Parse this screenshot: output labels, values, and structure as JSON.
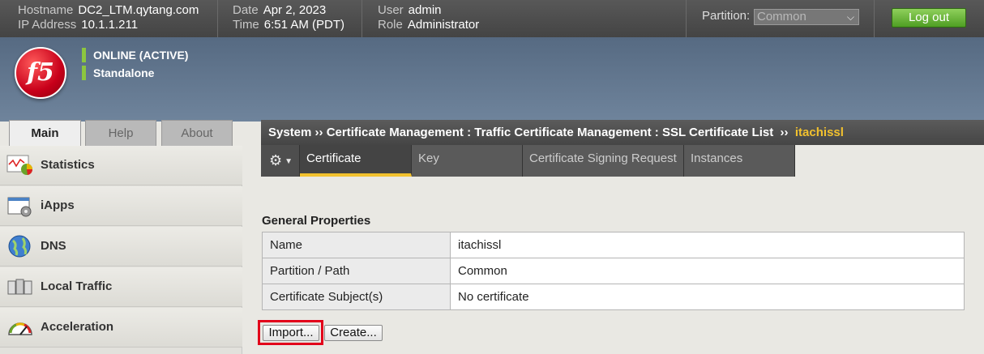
{
  "topbar": {
    "hostname_label": "Hostname",
    "hostname": "DC2_LTM.qytang.com",
    "ip_label": "IP Address",
    "ip": "10.1.1.211",
    "date_label": "Date",
    "date": "Apr 2, 2023",
    "time_label": "Time",
    "time": "6:51 AM (PDT)",
    "user_label": "User",
    "user": "admin",
    "role_label": "Role",
    "role": "Administrator",
    "partition_label": "Partition:",
    "partition_value": "Common",
    "logout_label": "Log out"
  },
  "banner": {
    "logo_text": "f5",
    "status_line1": "ONLINE (ACTIVE)",
    "status_line2": "Standalone",
    "status_color": "#8cc63f"
  },
  "nav_tabs": [
    "Main",
    "Help",
    "About"
  ],
  "menu": [
    {
      "label": "Statistics",
      "icon": "statistics-icon"
    },
    {
      "label": "iApps",
      "icon": "iapps-icon"
    },
    {
      "label": "DNS",
      "icon": "dns-globe-icon"
    },
    {
      "label": "Local Traffic",
      "icon": "local-traffic-icon"
    },
    {
      "label": "Acceleration",
      "icon": "acceleration-gauge-icon"
    }
  ],
  "breadcrumb": {
    "path": "System  ››  Certificate Management : Traffic Certificate Management : SSL Certificate List",
    "sep": "  ››  ",
    "current": "itachissl",
    "current_color": "#f2c12e"
  },
  "tabs": [
    "Certificate",
    "Key",
    "Certificate Signing Request",
    "Instances"
  ],
  "active_tab": "Certificate",
  "general": {
    "title": "General Properties",
    "rows": [
      {
        "key": "Name",
        "value": "itachissl"
      },
      {
        "key": "Partition / Path",
        "value": "Common"
      },
      {
        "key": "Certificate Subject(s)",
        "value": "No certificate"
      }
    ]
  },
  "buttons": {
    "import": "Import...",
    "create": "Create..."
  }
}
